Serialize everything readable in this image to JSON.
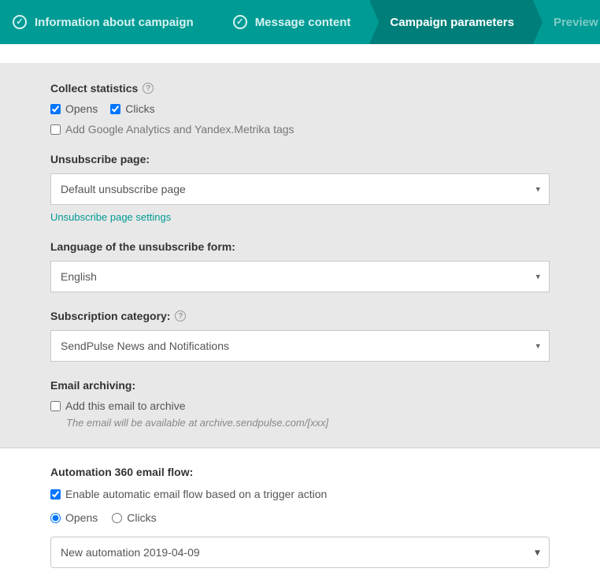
{
  "steps": {
    "info": "Information about campaign",
    "msg": "Message content",
    "params": "Campaign parameters",
    "preview": "Preview and send"
  },
  "stats": {
    "label": "Collect statistics",
    "opens": "Opens",
    "clicks": "Clicks",
    "ga": "Add Google Analytics and Yandex.Metrika tags"
  },
  "unsub": {
    "label": "Unsubscribe page:",
    "selected": "Default unsubscribe page",
    "settings_link": "Unsubscribe page settings"
  },
  "lang": {
    "label": "Language of the unsubscribe form:",
    "selected": "English"
  },
  "cat": {
    "label": "Subscription category:",
    "selected": "SendPulse News and Notifications"
  },
  "archive": {
    "label": "Email archiving:",
    "check": "Add this email to archive",
    "hint": "The email will be available at archive.sendpulse.com/[xxx]"
  },
  "auto": {
    "label": "Automation 360 email flow:",
    "enable": "Enable automatic email flow based on a trigger action",
    "opens": "Opens",
    "clicks": "Clicks",
    "selected": "New automation 2019-04-09"
  }
}
